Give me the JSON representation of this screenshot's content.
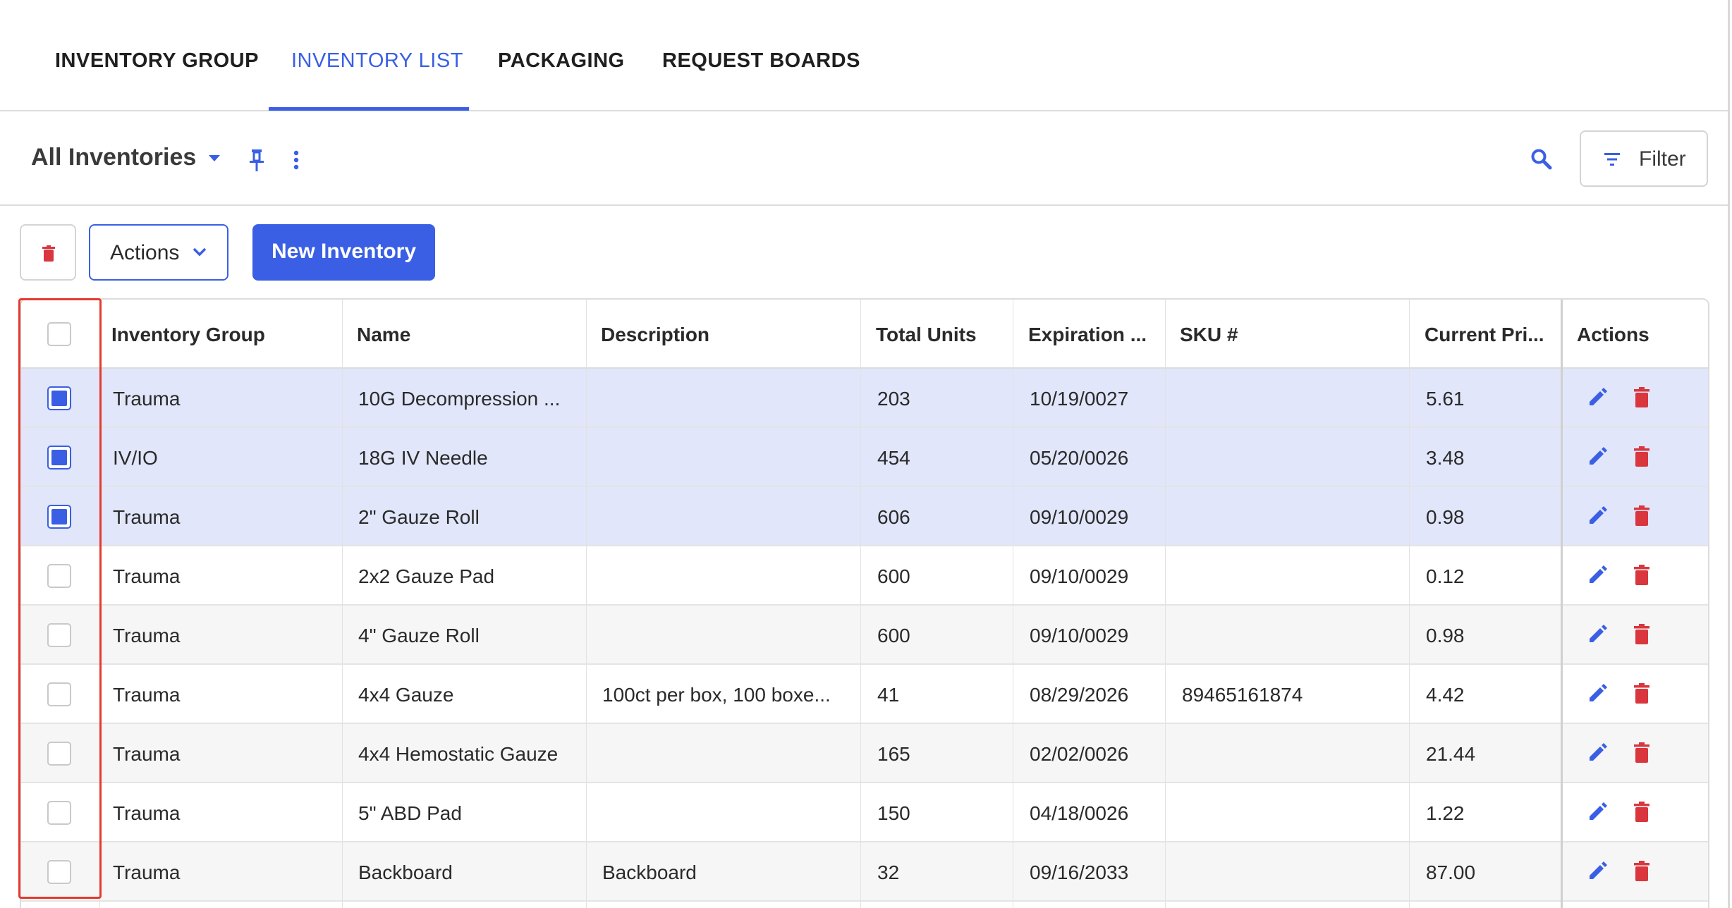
{
  "tabs": [
    {
      "label": "INVENTORY GROUP",
      "active": false
    },
    {
      "label": "INVENTORY LIST",
      "active": true
    },
    {
      "label": "PACKAGING",
      "active": false
    },
    {
      "label": "REQUEST BOARDS",
      "active": false
    }
  ],
  "toolbar": {
    "view_title": "All Inventories",
    "filter_label": "Filter"
  },
  "action_bar": {
    "actions_label": "Actions",
    "new_label": "New Inventory"
  },
  "table": {
    "columns": [
      "Inventory Group",
      "Name",
      "Description",
      "Total Units",
      "Expiration ...",
      "SKU #",
      "Current Pri...",
      "Actions"
    ],
    "rows": [
      {
        "selected": true,
        "group": "Trauma",
        "name": "10G Decompression ...",
        "description": "",
        "units": "203",
        "expiration": "10/19/0027",
        "sku": "",
        "price": "5.61"
      },
      {
        "selected": true,
        "group": "IV/IO",
        "name": "18G IV Needle",
        "description": "",
        "units": "454",
        "expiration": "05/20/0026",
        "sku": "",
        "price": "3.48"
      },
      {
        "selected": true,
        "group": "Trauma",
        "name": "2\" Gauze Roll",
        "description": "",
        "units": "606",
        "expiration": "09/10/0029",
        "sku": "",
        "price": "0.98"
      },
      {
        "selected": false,
        "group": "Trauma",
        "name": "2x2 Gauze Pad",
        "description": "",
        "units": "600",
        "expiration": "09/10/0029",
        "sku": "",
        "price": "0.12"
      },
      {
        "selected": false,
        "group": "Trauma",
        "name": "4\" Gauze Roll",
        "description": "",
        "units": "600",
        "expiration": "09/10/0029",
        "sku": "",
        "price": "0.98"
      },
      {
        "selected": false,
        "group": "Trauma",
        "name": "4x4 Gauze",
        "description": "100ct per box, 100 boxe...",
        "units": "41",
        "expiration": "08/29/2026",
        "sku": "89465161874",
        "price": "4.42"
      },
      {
        "selected": false,
        "group": "Trauma",
        "name": "4x4 Hemostatic Gauze",
        "description": "",
        "units": "165",
        "expiration": "02/02/0026",
        "sku": "",
        "price": "21.44"
      },
      {
        "selected": false,
        "group": "Trauma",
        "name": "5\" ABD Pad",
        "description": "",
        "units": "150",
        "expiration": "04/18/0026",
        "sku": "",
        "price": "1.22"
      },
      {
        "selected": false,
        "group": "Trauma",
        "name": "Backboard",
        "description": "Backboard",
        "units": "32",
        "expiration": "09/16/2033",
        "sku": "",
        "price": "87.00"
      }
    ]
  },
  "colors": {
    "accent": "#3a5fe5",
    "danger": "#d9363e",
    "selected_row": "#e1e6fa",
    "highlight": "#e53a2f"
  },
  "icons": [
    "caret-down-icon",
    "pin-icon",
    "kebab-icon",
    "search-icon",
    "filter-icon",
    "trash-icon",
    "chevron-down-icon",
    "edit-icon"
  ]
}
